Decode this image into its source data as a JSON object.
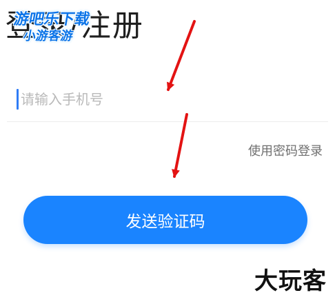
{
  "title": "登录/注册",
  "watermark": {
    "line1": "游吧乐下载",
    "line2": "小游客游"
  },
  "phone": {
    "placeholder": "请输入手机号",
    "value": ""
  },
  "links": {
    "password_login": "使用密码登录"
  },
  "actions": {
    "send_code": "发送验证码"
  },
  "brand": "大玩客",
  "colors": {
    "primary": "#1a84ff",
    "arrow": "#e31313",
    "cursor": "#2f7cf6",
    "watermark": "#0b74e8"
  },
  "icons": {
    "annotation_arrow": "red-arrow-icon"
  }
}
